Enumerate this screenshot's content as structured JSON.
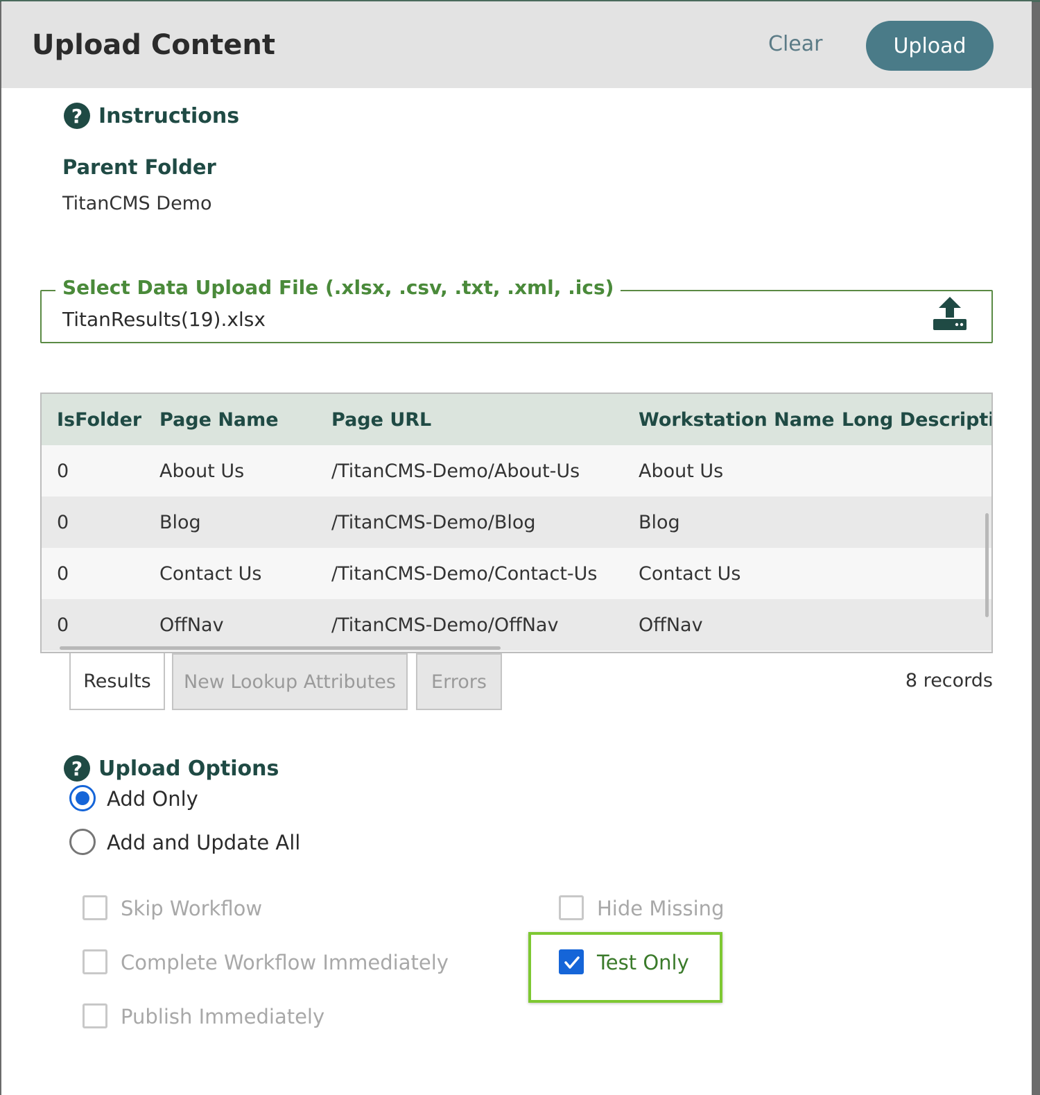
{
  "header": {
    "title": "Upload Content",
    "clear_label": "Clear",
    "upload_label": "Upload"
  },
  "instructions": {
    "label": "Instructions"
  },
  "parent_folder": {
    "label": "Parent Folder",
    "value": "TitanCMS Demo"
  },
  "file_select": {
    "legend": "Select Data Upload File (.xlsx, .csv, .txt, .xml, .ics)",
    "value": "TitanResults(19).xlsx",
    "icon": "upload-icon"
  },
  "grid": {
    "columns": [
      "IsFolder",
      "Page Name",
      "Page URL",
      "Workstation Name",
      "Long Description"
    ],
    "rows": [
      [
        "0",
        "About Us",
        "/TitanCMS-Demo/About-Us",
        "About Us",
        ""
      ],
      [
        "0",
        "Blog",
        "/TitanCMS-Demo/Blog",
        "Blog",
        ""
      ],
      [
        "0",
        "Contact Us",
        "/TitanCMS-Demo/Contact-Us",
        "Contact Us",
        ""
      ],
      [
        "0",
        "OffNav",
        "/TitanCMS-Demo/OffNav",
        "OffNav",
        ""
      ]
    ]
  },
  "tabs": [
    {
      "label": "Results",
      "active": true
    },
    {
      "label": "New Lookup Attributes",
      "active": false
    },
    {
      "label": "Errors",
      "active": false
    }
  ],
  "records": "8 records",
  "upload_options": {
    "label": "Upload Options",
    "radios": [
      {
        "label": "Add Only",
        "checked": true
      },
      {
        "label": "Add and Update All",
        "checked": false
      }
    ],
    "checkboxes": {
      "skip_workflow": {
        "label": "Skip Workflow",
        "checked": false
      },
      "complete_workflow": {
        "label": "Complete Workflow Immediately",
        "checked": false
      },
      "publish_immediately": {
        "label": "Publish Immediately",
        "checked": false
      },
      "hide_missing": {
        "label": "Hide Missing",
        "checked": false
      },
      "test_only": {
        "label": "Test Only",
        "checked": true
      }
    }
  },
  "colors": {
    "accent": "#4a7b88",
    "heading": "#1f4a44",
    "highlight": "#7ec832",
    "checkbox_checked": "#1565d8"
  }
}
